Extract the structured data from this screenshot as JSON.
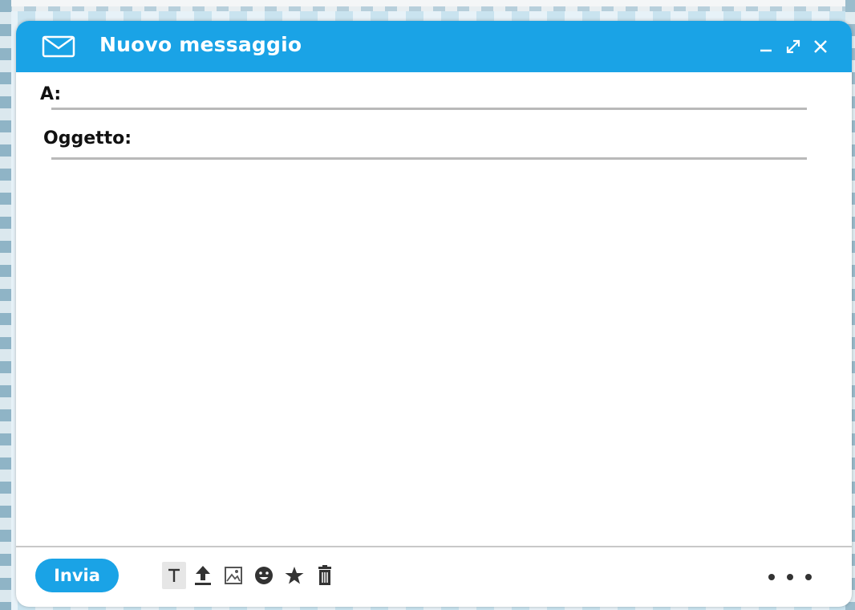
{
  "window": {
    "title": "Nuovo messaggio",
    "controls": {
      "minimize_icon": "minimize-icon",
      "expand_icon": "expand-icon",
      "close_icon": "close-icon"
    }
  },
  "compose": {
    "to_label": "A:",
    "to_value": "",
    "subject_label": "Oggetto:",
    "subject_value": "",
    "body_value": ""
  },
  "footer": {
    "send_label": "Invia",
    "tools": [
      "text-format-icon",
      "attach-upload-icon",
      "insert-image-icon",
      "emoji-icon",
      "star-icon",
      "trash-icon"
    ],
    "more_icon": "more-options-icon"
  },
  "colors": {
    "accent": "#1aa3e6",
    "divider": "#b9b9b9",
    "text": "#111111"
  }
}
